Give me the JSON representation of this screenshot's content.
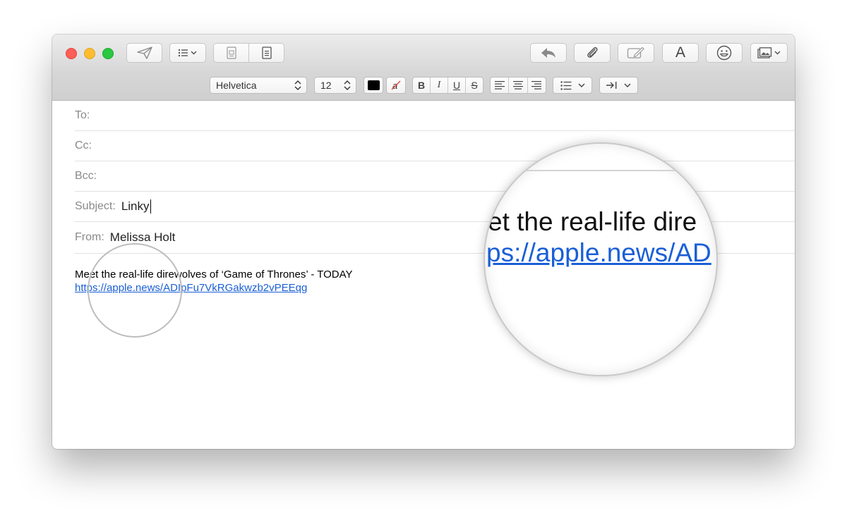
{
  "toolbar": {
    "icons": [
      "send-icon",
      "header-fields-icon",
      "attachments-icon",
      "stationery-icon",
      "reply-icon",
      "attach-icon",
      "markup-icon",
      "fonts-icon",
      "emoji-icon",
      "photo-browser-icon"
    ],
    "fonts_glyph": "A"
  },
  "format": {
    "font_family": "Helvetica",
    "font_size": "12",
    "bold": "B",
    "italic": "I",
    "underline": "U",
    "strike": "S"
  },
  "compose": {
    "to_label": "To:",
    "to_value": "",
    "cc_label": "Cc:",
    "cc_value": "",
    "bcc_label": "Bcc:",
    "bcc_value": "",
    "subject_label": "Subject:",
    "subject_value": "Linky",
    "from_label": "From:",
    "from_value": "Melissa Holt"
  },
  "message": {
    "line1": "Meet the real-life direwolves of ‘Game of Thrones’ - TODAY",
    "link": "https://apple.news/ADIpFu7VkRGakwzb2vPEEqg"
  },
  "magnifier": {
    "text1": "et the real-life dire",
    "text2": "ps://apple.news/AD"
  },
  "colors": {
    "link": "#1a5fd6",
    "close": "#fe5f57",
    "minimize": "#febc2e",
    "zoom": "#28c840"
  }
}
